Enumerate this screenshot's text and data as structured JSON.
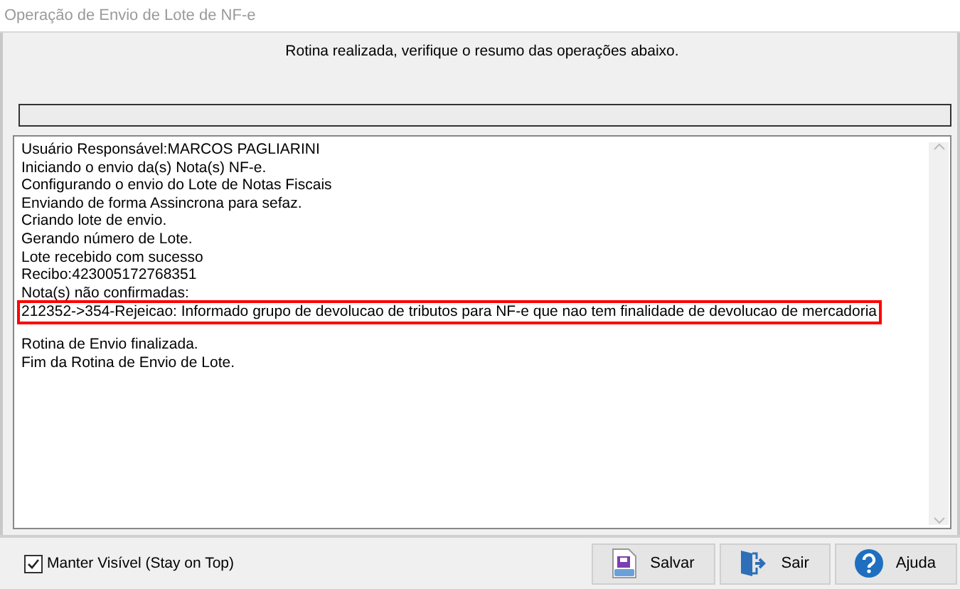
{
  "window": {
    "title": "Operação de Envio de Lote de NF-e"
  },
  "header": "Rotina realizada, verifique o resumo das operações abaixo.",
  "log": {
    "blocks": [
      {
        "lines": [
          {
            "text": "Usuário Responsável:MARCOS PAGLIARINI",
            "highlighted": false
          },
          {
            "text": "Iniciando o envio da(s) Nota(s) NF-e.",
            "highlighted": false
          },
          {
            "text": "Configurando o envio do Lote de Notas Fiscais",
            "highlighted": false
          },
          {
            "text": "Enviando de forma Assincrona para sefaz.",
            "highlighted": false
          },
          {
            "text": "Criando lote de envio.",
            "highlighted": false
          },
          {
            "text": "Gerando número de Lote.",
            "highlighted": false
          },
          {
            "text": "Lote recebido com sucesso",
            "highlighted": false
          },
          {
            "text": "Recibo:423005172768351",
            "highlighted": false
          },
          {
            "text": "Nota(s) não confirmadas:",
            "highlighted": false
          },
          {
            "text": "212352->354-Rejeicao: Informado grupo de devolucao de tributos para NF-e que nao tem finalidade de devolucao de mercadoria",
            "highlighted": true
          }
        ]
      },
      {
        "lines": [
          {
            "text": "Rotina de Envio finalizada.",
            "highlighted": false
          },
          {
            "text": "Fim da Rotina de Envio de Lote.",
            "highlighted": false
          }
        ]
      }
    ]
  },
  "stay_on_top": {
    "label": "Manter Visível (Stay on Top)",
    "checked": true
  },
  "buttons": [
    {
      "kind": "save",
      "label": "Salvar"
    },
    {
      "kind": "exit",
      "label": "Sair"
    },
    {
      "kind": "help",
      "label": "Ajuda"
    }
  ]
}
